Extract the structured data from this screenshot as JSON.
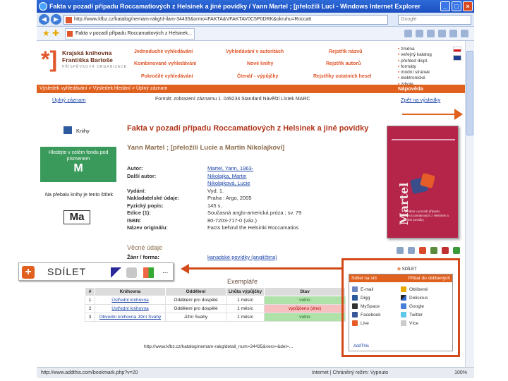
{
  "window": {
    "title": "Fakta v pozadí případu Roccamatiových z Helsinek a jiné povídky / Yann Martel ; [přeložili Luci - Windows Internet Explorer",
    "address": "http://www.kfbz.cz/katalog/nemam-rakg!d-ilam-34435&ormo=FAKTA&VFAKTAV0C5P0DRK&okruhu=Roccatt",
    "search_placeholder": "Google",
    "tab_label": "Fakta v pozadí případu Roccamatiových z Helsinek...",
    "status_url": "http://www.addthis.com/bookmark.php?v=20",
    "zone": "Internet | Chráněný režim: Vypnuto",
    "zoom": "100%"
  },
  "header": {
    "logo_line1": "Krajská knihovna",
    "logo_line2": "Františka Bartoše",
    "logo_sub": "PŘÍSPĚVKOVÁ ORGANIZACE",
    "nav": [
      "Jednoduché vyhledávání",
      "Vyhledávání v autoritách",
      "Rejstřík názvů",
      "Kombinované vyhledávání",
      "Nové knihy",
      "Rejstřík autorů",
      "Pokročilé vyhledávání",
      "Čtenář - výpůjčky",
      "Rejstříky ostatních hesel"
    ],
    "langs": [
      "změna",
      "veřejný katalog",
      "přehled displ.",
      "formáty",
      "módní stránek",
      "elektronické",
      "zdroje"
    ],
    "orange_text": "Výsledek vyhledávání > Výsledek hledání > Úplný záznam",
    "help": "Nápověda"
  },
  "record": {
    "subnav_link": "Úplný záznam",
    "subnav_formats": "Formát: zobrazení záznamu  1. 049234  Standard  Návěští  Lístek  MARC",
    "back": "Zpět na výsledky",
    "category": "Knihy",
    "green_box_text": "Hledejte v celém fondu pod písmenem",
    "green_box_letter": "M",
    "hint": "Na přebalu knihy je tento štítek",
    "ma": "Ma",
    "title": "Fakta v pozadí případu Roccamatiových z Helsinek a jiné povídky",
    "author_line": "Yann Martel ; [přeložili Lucie a Martin Nikolajkovi]",
    "meta": [
      {
        "label": "Autor:",
        "value": "Martel, Yann, 1963-",
        "link": true
      },
      {
        "label": "Další autor:",
        "value": "Nikolajka, Martin",
        "link": true
      },
      {
        "label": "",
        "value": "Nikolajková, Lucie",
        "link": true
      },
      {
        "label": "Vydání:",
        "value": "Vyd. 1.",
        "link": false
      },
      {
        "label": "Nakladatelské údaje:",
        "value": "Praha : Argo, 2005",
        "link": false
      },
      {
        "label": "Fyzický popis:",
        "value": "145 s.",
        "link": false
      },
      {
        "label": "Edice (1):",
        "value": "Současná anglo-americká próza ; sv. 79",
        "link": false
      },
      {
        "label": "ISBN:",
        "value": "80-7203-717-0 (váz.)",
        "link": false
      },
      {
        "label": "Název originálu:",
        "value": "Facts behind the Helsinki Roccamatios",
        "link": false
      }
    ],
    "vecne": "Věcné údaje",
    "zanr_label": "Žánr / forma:",
    "zanr_value": "kanadské povídky (angličtina)",
    "cover_title": "Martel",
    "cover_sub": "Fakta v pozadí případu Roccamatiových z Helsinek a jiné povídky"
  },
  "share": {
    "label": "SDÍLET",
    "more": "...",
    "small_label": "SDÍLET",
    "dropdown_head": "Sdílet na síti",
    "dropdown_head2": "Přidat do oblíbených",
    "items": [
      "E-mail",
      "Oblíbené",
      "Digg",
      "Delicious",
      "MySpace",
      "Google",
      "Facebook",
      "Twitter",
      "Live",
      "Více"
    ],
    "foot": "AddThis"
  },
  "exemplare": {
    "heading": "Exempláře",
    "columns": [
      "#",
      "Knihovna",
      "Oddělení",
      "Lhůta výpůjčky",
      "Stav"
    ],
    "rows": [
      [
        "1",
        "Ústřední knihovna",
        "Oddělení pro dospělé",
        "1 měsíc",
        "volno"
      ],
      [
        "2",
        "Ústřední knihovna",
        "Oddělení pro dospělé",
        "1 měsíc",
        "vypůjčeno (dne)"
      ],
      [
        "3",
        "Obvodní knihovna Jižní Svahy",
        "Jižní Svahy",
        "1 měsíc",
        "volno"
      ]
    ],
    "permalink": "http://www.kfbz.cz/katalog/nemam-rakg!detail_num=34435&vers=&del=..."
  }
}
